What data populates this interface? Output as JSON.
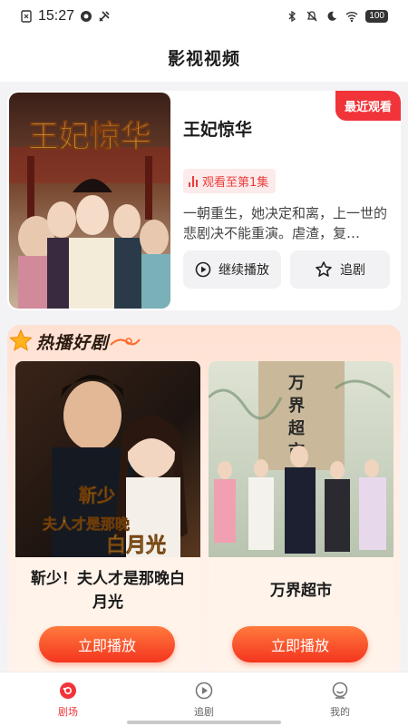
{
  "status_bar": {
    "time": "15:27",
    "battery": "100"
  },
  "header": {
    "title": "影视视频"
  },
  "recent": {
    "badge": "最近观看",
    "title": "王妃惊华",
    "poster_text": "王妃惊华",
    "progress": "观看至第1集",
    "description": "一朝重生，她决定和离，上一世的悲剧决不能重演。虐渣，复…",
    "continue_label": "继续播放",
    "follow_label": "追剧"
  },
  "hot": {
    "title": "热播好剧",
    "dramas": [
      {
        "name": "靳少！夫人才是那晚白月光",
        "poster_text": "靳少 夫人才是那晚白月光",
        "button": "立即播放"
      },
      {
        "name": "万界超市",
        "poster_text": "万界超市",
        "button": "立即播放"
      }
    ]
  },
  "nav": {
    "items": [
      {
        "label": "剧场",
        "icon": "theater-icon",
        "active": true
      },
      {
        "label": "追剧",
        "icon": "play-circle-icon",
        "active": false
      },
      {
        "label": "我的",
        "icon": "user-icon",
        "active": false
      }
    ]
  },
  "colors": {
    "accent": "#f0343a",
    "play_gradient_start": "#ff7a3d",
    "play_gradient_end": "#f4351f"
  }
}
